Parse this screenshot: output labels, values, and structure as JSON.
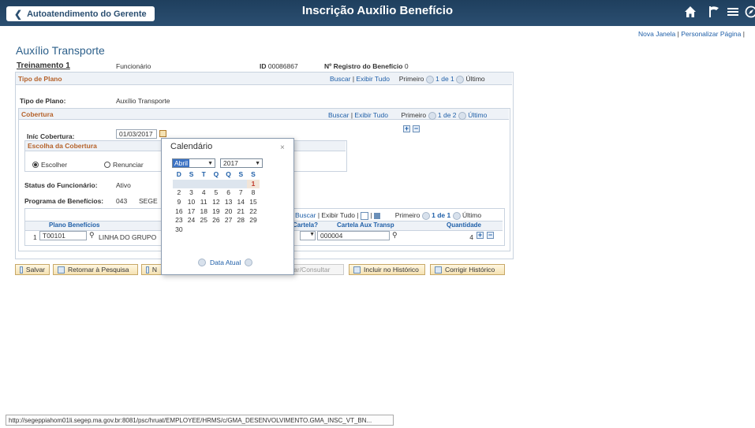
{
  "header": {
    "back_label": "Autoatendimento do Gerente",
    "title": "Inscrição Auxílio Benefício"
  },
  "top_links": {
    "new_window": "Nova Janela",
    "separator": "|",
    "personalize": "Personalizar Página"
  },
  "page": {
    "heading": "Auxílio Transporte",
    "employee_name": "Treinamento 1",
    "employee_role": "Funcionário",
    "id_label": "ID",
    "id_value": "00086867",
    "benefit_reg_label": "Nº Registro do Benefício",
    "benefit_reg_value": "0"
  },
  "tipo_plano": {
    "section_title": "Tipo de Plano",
    "buscar": "Buscar",
    "exibir_tudo": "Exibir Tudo",
    "primeiro": "Primeiro",
    "count": "1 de 1",
    "ultimo": "Último",
    "field_label": "Tipo de Plano:",
    "field_value": "Auxílio Transporte"
  },
  "cobertura": {
    "section_title": "Cobertura",
    "buscar": "Buscar",
    "exibir_tudo": "Exibir Tudo",
    "primeiro": "Primeiro",
    "count": "1 de 2",
    "ultimo": "Último",
    "inic_label": "Iníc Cobertura:",
    "inic_value": "01/03/2017",
    "escolha_title": "Escolha da Cobertura",
    "escolher": "Escolher",
    "renunciar": "Renunciar",
    "status_label": "Status do Funcionário:",
    "status_value": "Ativo",
    "programa_label": "Programa de Benefícios:",
    "programa_code": "043",
    "programa_name": "SEGE"
  },
  "grid": {
    "buscar": "Buscar",
    "exibir_tudo": "Exibir Tudo",
    "primeiro": "Primeiro",
    "count": "1 de 1",
    "ultimo": "Último",
    "col_plano": "Plano Benefícios",
    "col_cartela": "Cartela?",
    "col_cartela_aux": "Cartela Aux Transp",
    "col_quantidade": "Quantidade",
    "row_num": "1",
    "row_plano": "T00101",
    "row_desc": "LINHA DO GRUPO",
    "row_cartela_aux": "000004",
    "row_quantidade": "4"
  },
  "calendar": {
    "title": "Calendário",
    "close": "×",
    "month": "Abril",
    "year": "2017",
    "weekdays": [
      "D",
      "S",
      "T",
      "Q",
      "Q",
      "S",
      "S"
    ],
    "weeks": [
      [
        "",
        "",
        "",
        "",
        "",
        "",
        "1"
      ],
      [
        "2",
        "3",
        "4",
        "5",
        "6",
        "7",
        "8"
      ],
      [
        "9",
        "10",
        "11",
        "12",
        "13",
        "14",
        "15"
      ],
      [
        "16",
        "17",
        "18",
        "19",
        "20",
        "21",
        "22"
      ],
      [
        "23",
        "24",
        "25",
        "26",
        "27",
        "28",
        "29"
      ],
      [
        "30",
        "",
        "",
        "",
        "",
        "",
        ""
      ]
    ],
    "selected_day": "1",
    "today_label": "Data Atual"
  },
  "buttons": {
    "salvar": "Salvar",
    "retornar": "Retornar à Pesquisa",
    "n": "N",
    "atualizar": "izar/Consultar",
    "incluir": "Incluir no Histórico",
    "corrigir": "Corrigir Histórico"
  },
  "statusbar": "http://segeppiahom01li.segep.ma.gov.br:8081/psc/hruat/EMPLOYEE/HRMS/c/GMA_DESENVOLVIMENTO.GMA_INSC_VT_BN..."
}
